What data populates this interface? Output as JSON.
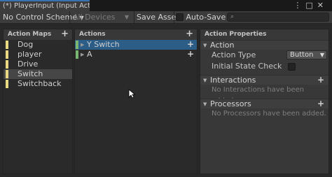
{
  "window": {
    "tab_title": "(*) PlayerInput (Input Acti...",
    "menu_icon": "kebab-menu-icon",
    "maximize_icon": "maximize-icon",
    "close_icon": "close-icon"
  },
  "toolbar": {
    "control_scheme": "No Control Scheme",
    "devices": "All Devices",
    "save_asset": "Save Asset",
    "auto_save": "Auto-Save",
    "search_placeholder": ""
  },
  "action_maps": {
    "header": "Action Maps",
    "items": [
      {
        "label": "Dog"
      },
      {
        "label": "player"
      },
      {
        "label": "Drive"
      },
      {
        "label": "Switch",
        "selected": true
      },
      {
        "label": "Switchback"
      }
    ]
  },
  "actions": {
    "header": "Actions",
    "items": [
      {
        "label": "Y Switch",
        "selected": true
      },
      {
        "label": "A",
        "selected": false
      }
    ]
  },
  "properties": {
    "header": "Action Properties",
    "action_section": "Action",
    "action_type_label": "Action Type",
    "action_type_value": "Button",
    "initial_state_label": "Initial State Check",
    "interactions_section": "Interactions",
    "interactions_empty": "No Interactions have been added.",
    "processors_section": "Processors",
    "processors_empty": "No Processors have been added."
  },
  "colors": {
    "accent_selection": "#2c5d87",
    "action_map_marker": "#e9d983",
    "action_marker": "#78b672",
    "tab_highlight": "#3a72b0"
  }
}
